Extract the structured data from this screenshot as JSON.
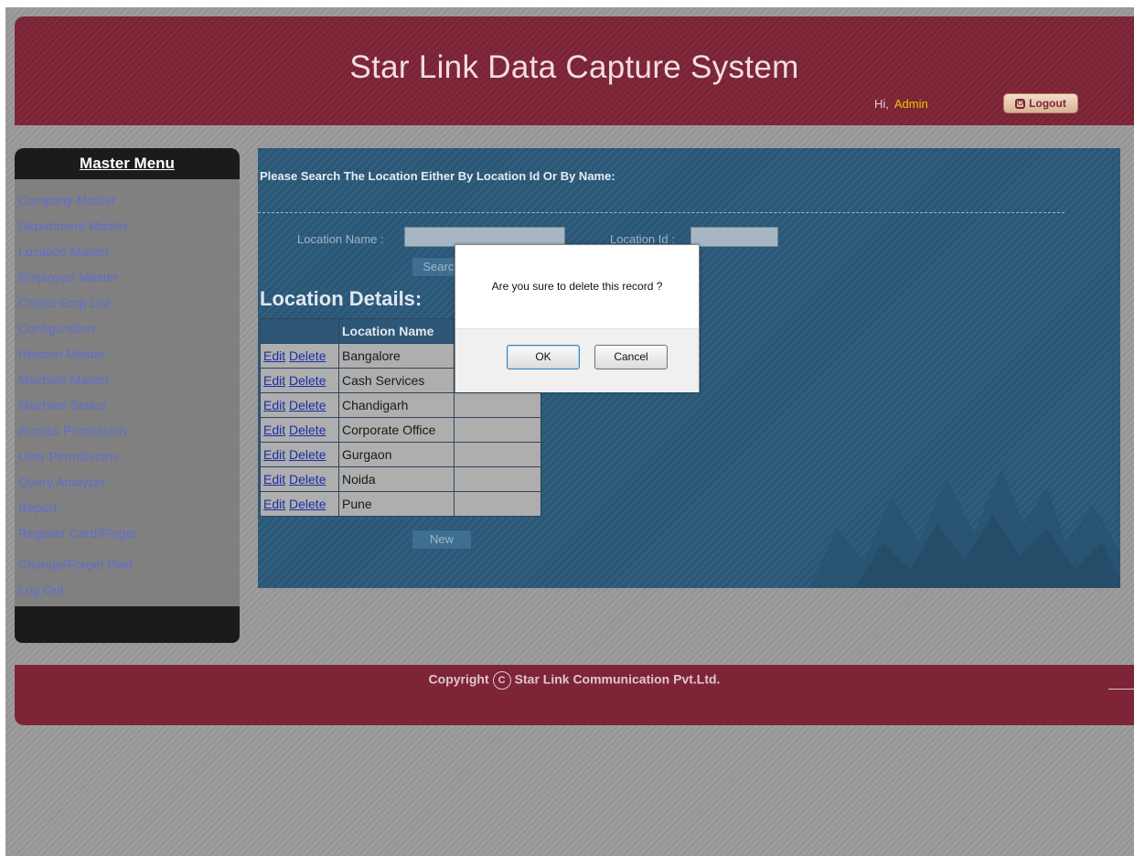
{
  "header": {
    "title": "Star Link Data Capture System",
    "greeting": "Hi,",
    "user": "Admin",
    "logout_label": "Logout"
  },
  "sidebar": {
    "title": "Master Menu",
    "items": [
      {
        "label": "Company Master"
      },
      {
        "label": "Department Master"
      },
      {
        "label": "Location Master"
      },
      {
        "label": "Employee Master"
      },
      {
        "label": "Create Emp List"
      },
      {
        "label": "Configuration"
      },
      {
        "label": "Reason Master"
      },
      {
        "label": "Machine Master"
      },
      {
        "label": "Machine Status"
      },
      {
        "label": "Access Permission"
      },
      {
        "label": "User Permissions"
      },
      {
        "label": "Query Analyzer"
      },
      {
        "label": "Report"
      },
      {
        "label": "Register Card/Finger"
      },
      {
        "label": "Change/Forget Pwd"
      },
      {
        "label": "Log Out"
      }
    ]
  },
  "search": {
    "heading": "Please Search The Location Either By Location Id Or By Name:",
    "location_name_label": "Location Name :",
    "location_name_value": "",
    "location_id_label": "Location Id :",
    "location_id_value": "",
    "search_button": "Search"
  },
  "details": {
    "title": "Location Details:",
    "columns": [
      "",
      "Location Name",
      ""
    ],
    "edit_label": "Edit",
    "delete_label": "Delete",
    "rows": [
      {
        "name": "Bangalore"
      },
      {
        "name": "Cash Services"
      },
      {
        "name": "Chandigarh"
      },
      {
        "name": "Corporate Office"
      },
      {
        "name": "Gurgaon"
      },
      {
        "name": "Noida"
      },
      {
        "name": "Pune"
      }
    ],
    "new_button": "New"
  },
  "footer": {
    "copyright_word": "Copyright",
    "copyright_symbol": "C",
    "company": "Star Link Communication Pvt.Ltd."
  },
  "dialog": {
    "message": "Are you sure to delete this record ?",
    "ok_label": "OK",
    "cancel_label": "Cancel"
  }
}
